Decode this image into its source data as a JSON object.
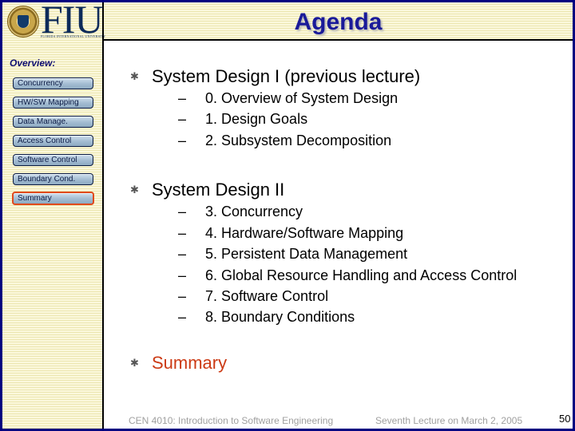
{
  "header": {
    "logo_text": "FIU",
    "logo_subtitle": "FLORIDA INTERNATIONAL UNIVERSITY",
    "title": "Agenda"
  },
  "sidebar": {
    "heading": "Overview:",
    "items": [
      {
        "label": "Concurrency",
        "active": false
      },
      {
        "label": "HW/SW Mapping",
        "active": false
      },
      {
        "label": "Data Manage.",
        "active": false
      },
      {
        "label": "Access Control",
        "active": false
      },
      {
        "label": "Software Control",
        "active": false
      },
      {
        "label": "Boundary Cond.",
        "active": false
      },
      {
        "label": "Summary",
        "active": true
      }
    ]
  },
  "content": {
    "bullets": [
      {
        "label": "System Design I (previous lecture)",
        "subitems": [
          "0. Overview of System Design",
          "1. Design Goals",
          "2. Subsystem Decomposition"
        ]
      },
      {
        "label": "System Design II",
        "subitems": [
          "3. Concurrency",
          "4. Hardware/Software Mapping",
          "5. Persistent Data Management",
          "6. Global Resource Handling and Access Control",
          "7. Software Control",
          "8. Boundary Conditions"
        ]
      },
      {
        "label": "Summary",
        "subitems": []
      }
    ],
    "bullet_icon": "asterisk-bullet-icon",
    "sub_marker": "–"
  },
  "footer": {
    "course": "CEN 4010: Introduction to Software Engineering",
    "lecture": "Seventh Lecture on March 2, 2005",
    "page_number": "50"
  },
  "colors": {
    "frame": "#000080",
    "title": "#1a1a99",
    "highlight": "#cc3a14",
    "active_border": "#e04a1c"
  }
}
